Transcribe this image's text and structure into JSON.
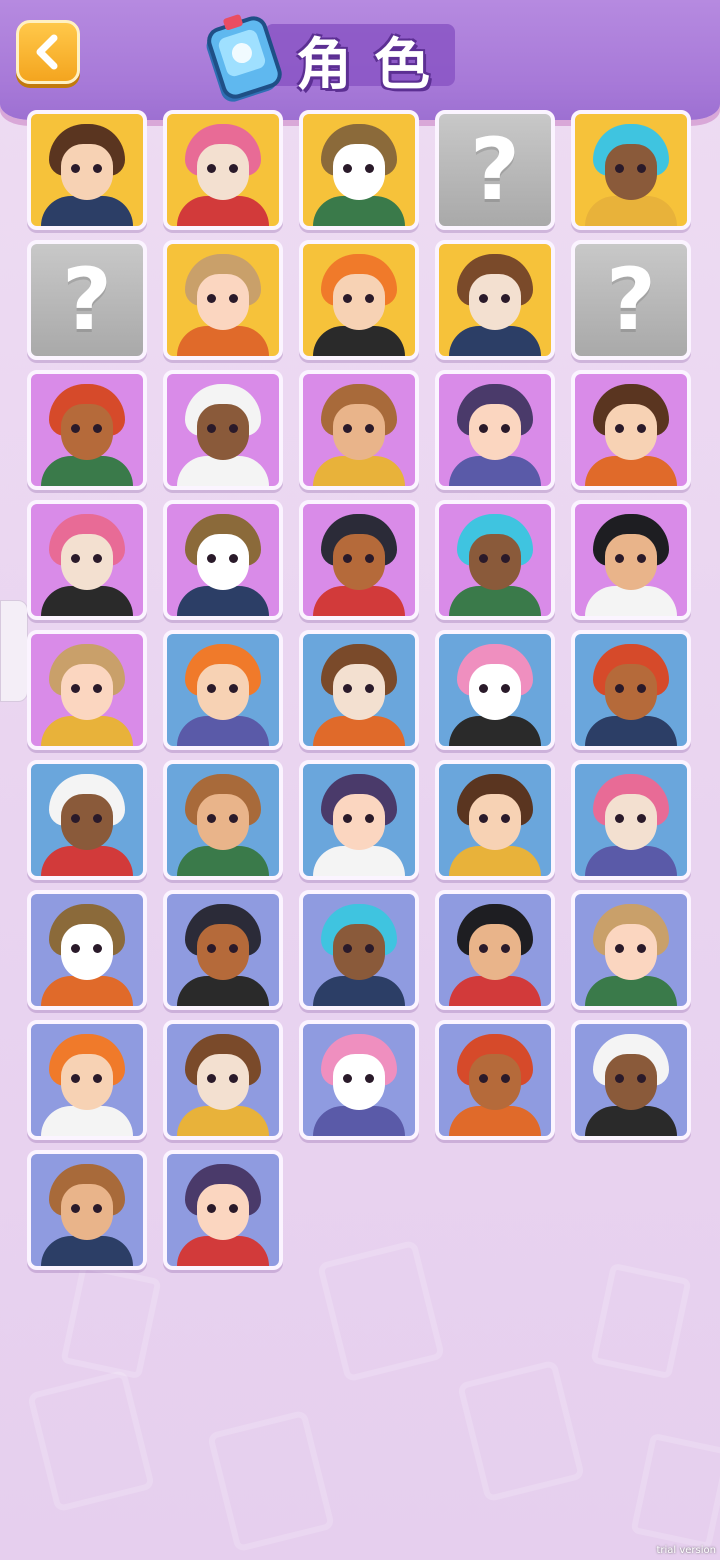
{
  "header": {
    "title": "角色",
    "back_icon": "chevron-left-icon",
    "title_icon": "character-card-icon"
  },
  "colors": {
    "header": "#a779d8",
    "tile_yellow": "#f6c23a",
    "tile_purple": "#d98be8",
    "tile_blue": "#6aa6dc",
    "tile_lavender": "#8f9be0",
    "tile_locked": "#b5b5b5"
  },
  "characters": [
    {
      "status": "unlocked",
      "bg": "yellow"
    },
    {
      "status": "unlocked",
      "bg": "yellow"
    },
    {
      "status": "unlocked",
      "bg": "yellow"
    },
    {
      "status": "locked",
      "bg": "locked",
      "label": "?"
    },
    {
      "status": "unlocked",
      "bg": "yellow"
    },
    {
      "status": "locked",
      "bg": "locked",
      "label": "?"
    },
    {
      "status": "unlocked",
      "bg": "yellow"
    },
    {
      "status": "unlocked",
      "bg": "yellow"
    },
    {
      "status": "unlocked",
      "bg": "yellow"
    },
    {
      "status": "locked",
      "bg": "locked",
      "label": "?"
    },
    {
      "status": "unlocked",
      "bg": "purple"
    },
    {
      "status": "unlocked",
      "bg": "purple"
    },
    {
      "status": "unlocked",
      "bg": "purple"
    },
    {
      "status": "unlocked",
      "bg": "purple"
    },
    {
      "status": "unlocked",
      "bg": "purple"
    },
    {
      "status": "unlocked",
      "bg": "purple"
    },
    {
      "status": "unlocked",
      "bg": "purple"
    },
    {
      "status": "unlocked",
      "bg": "purple"
    },
    {
      "status": "unlocked",
      "bg": "purple"
    },
    {
      "status": "unlocked",
      "bg": "purple"
    },
    {
      "status": "unlocked",
      "bg": "purple"
    },
    {
      "status": "unlocked",
      "bg": "blue"
    },
    {
      "status": "unlocked",
      "bg": "blue"
    },
    {
      "status": "unlocked",
      "bg": "blue"
    },
    {
      "status": "unlocked",
      "bg": "blue"
    },
    {
      "status": "unlocked",
      "bg": "blue"
    },
    {
      "status": "unlocked",
      "bg": "blue"
    },
    {
      "status": "unlocked",
      "bg": "blue"
    },
    {
      "status": "unlocked",
      "bg": "blue"
    },
    {
      "status": "unlocked",
      "bg": "blue"
    },
    {
      "status": "unlocked",
      "bg": "lavender"
    },
    {
      "status": "unlocked",
      "bg": "lavender"
    },
    {
      "status": "unlocked",
      "bg": "lavender"
    },
    {
      "status": "unlocked",
      "bg": "lavender"
    },
    {
      "status": "unlocked",
      "bg": "lavender"
    },
    {
      "status": "unlocked",
      "bg": "lavender"
    },
    {
      "status": "unlocked",
      "bg": "lavender"
    },
    {
      "status": "unlocked",
      "bg": "lavender"
    },
    {
      "status": "unlocked",
      "bg": "lavender"
    },
    {
      "status": "unlocked",
      "bg": "lavender"
    },
    {
      "status": "unlocked",
      "bg": "lavender"
    },
    {
      "status": "unlocked",
      "bg": "lavender"
    }
  ],
  "watermark": "trial version"
}
